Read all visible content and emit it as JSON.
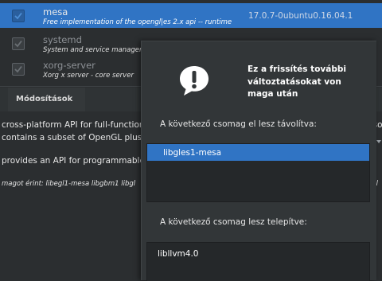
{
  "packages": [
    {
      "name": "mesa",
      "description": "Free implementation of the opengl|es 2.x api -- runtime",
      "version": "17.0.7-0ubuntu0.16.04.1",
      "selected": true
    },
    {
      "name": "systemd",
      "description": "System and service manager",
      "version": "",
      "selected": false
    },
    {
      "name": "xorg-server",
      "description": "Xorg x server - core server",
      "version": "",
      "selected": false
    }
  ],
  "tab": {
    "label": "Módosítások"
  },
  "details": {
    "line1": "cross-platform API for full-function",
    "line2": "contains a subset of OpenGL plus a",
    "line3": "provides an API for programmable",
    "line4": "magot érint:  libegl1-mesa libgbm1 libgl",
    "right1": "nso",
    "right4": "egl"
  },
  "dialog": {
    "title": "Ez a frissítés további változtatásokat von maga után",
    "removed_label": "A következő csomag el lesz távolítva:",
    "removed_items": [
      "libgles1-mesa"
    ],
    "installed_label": "A következő csomag lesz telepítve:",
    "installed_items": [
      "libllvm4.0"
    ]
  },
  "colors": {
    "selection": "#3074c4",
    "background": "#2b2e30",
    "dialog": "#323638"
  }
}
